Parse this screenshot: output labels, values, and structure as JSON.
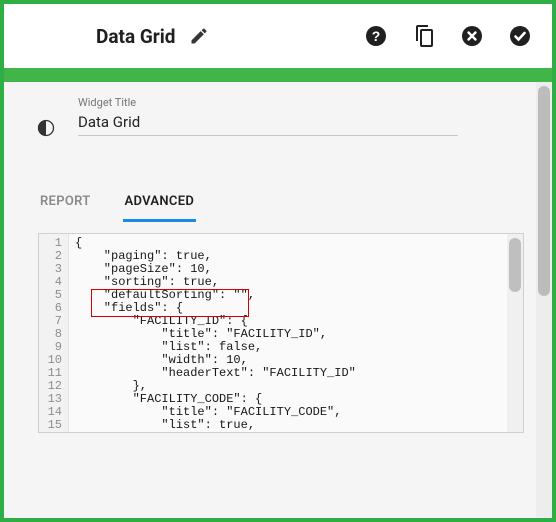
{
  "header": {
    "title": "Data Grid"
  },
  "widget": {
    "label": "Widget Title",
    "value": "Data Grid"
  },
  "tabs": {
    "report": "REPORT",
    "advanced": "ADVANCED",
    "active": "advanced"
  },
  "editor": {
    "gutter": "1\n2\n3\n4\n5\n6\n7\n8\n9\n10\n11\n12\n13\n14\n15",
    "code": "{\n    \"paging\": true,\n    \"pageSize\": 10,\n    \"sorting\": true,\n    \"defaultSorting\": \"\",\n    \"fields\": {\n        \"FACILITY_ID\": {\n            \"title\": \"FACILITY_ID\",\n            \"list\": false,\n            \"width\": 10,\n            \"headerText\": \"FACILITY_ID\"\n        },\n        \"FACILITY_CODE\": {\n            \"title\": \"FACILITY_CODE\",\n            \"list\": true,"
  },
  "icons": {
    "edit": "edit-icon",
    "help": "help-icon",
    "copy": "copy-icon",
    "cancel": "cancel-icon",
    "confirm": "confirm-icon",
    "theme": "theme-icon"
  }
}
